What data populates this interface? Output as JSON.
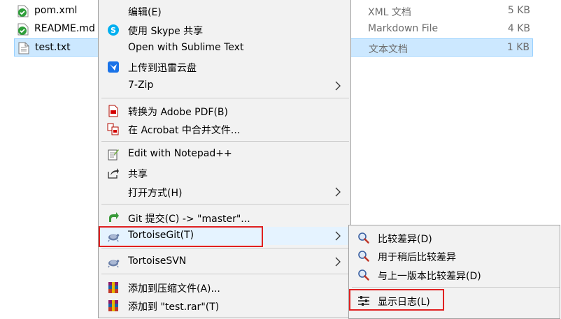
{
  "files": [
    {
      "name": "pom.xml",
      "type": "XML 文档",
      "size": "5 KB",
      "icon": "git-file-icon"
    },
    {
      "name": "README.md",
      "type": "Markdown File",
      "size": "4 KB",
      "icon": "git-file-icon"
    },
    {
      "name": "test.txt",
      "type": "文本文档",
      "size": "1 KB",
      "icon": "text-file-icon"
    }
  ],
  "menu": {
    "items": [
      {
        "label": "编辑(E)"
      },
      {
        "label": "使用 Skype 共享",
        "icon": "skype-icon"
      },
      {
        "label": "Open with Sublime Text"
      },
      {
        "label": "上传到迅雷云盘",
        "icon": "thunder-cloud-icon"
      },
      {
        "label": "7-Zip"
      },
      {
        "label": "转换为 Adobe PDF(B)",
        "icon": "adobe-pdf-icon"
      },
      {
        "label": "在 Acrobat 中合并文件...",
        "icon": "acrobat-combine-icon"
      },
      {
        "label": "Edit with Notepad++",
        "icon": "notepad-plus-plus-icon"
      },
      {
        "label": "共享",
        "icon": "share-icon"
      },
      {
        "label": "打开方式(H)"
      },
      {
        "label": "Git 提交(C) -> \"master\"...",
        "icon": "git-commit-icon"
      },
      {
        "label": "TortoiseGit(T)",
        "icon": "tortoisegit-icon"
      },
      {
        "label": "TortoiseSVN",
        "icon": "tortoisesvn-icon"
      },
      {
        "label": "添加到压缩文件(A)...",
        "icon": "winrar-icon"
      },
      {
        "label": "添加到 \"test.rar\"(T)",
        "icon": "winrar-icon"
      }
    ]
  },
  "submenu": {
    "items": [
      {
        "label": "比较差异(D)",
        "icon": "diff-magnifier-icon"
      },
      {
        "label": "用于稍后比较差异",
        "icon": "diff-magnifier-icon"
      },
      {
        "label": "与上一版本比较差异(D)",
        "icon": "diff-magnifier-icon"
      },
      {
        "label": "显示日志(L)",
        "icon": "show-log-icon"
      }
    ]
  },
  "colors": {
    "selection_bg": "#cce8ff",
    "selection_border": "#99d1ff",
    "menu_bg": "#f2f2f2",
    "highlight_box": "#e02020"
  }
}
